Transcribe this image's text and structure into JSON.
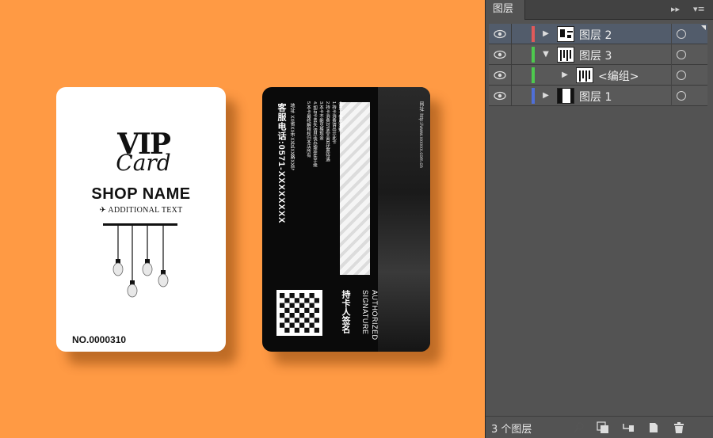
{
  "front_card": {
    "logo_vip": "VIP",
    "logo_card": "Card",
    "shop_name": "SHOP NAME",
    "additional_text": "ADDITIONAL TEXT",
    "card_number": "NO.0000310"
  },
  "back_card": {
    "phone": "客服电话:0571-XXXXXXXX",
    "address": "地址: XX省XX市XX区XX路XX号",
    "rules": [
      "会员卡使用须知",
      "1.持卡消费请出示此卡",
      "2.持卡消费可享受会员优惠待遇",
      "3.本卡不能兑换现金",
      "4.如有卡丢失,请尽快办理挂失手续",
      "5.本卡最终解释权归本店所有"
    ],
    "website": "网址: http://www.xxxxxx.com.cn",
    "authorized_line1": "AUTHORIZED",
    "authorized_line2": "SIGNATURE",
    "holder_signature": "持卡人签名"
  },
  "layers_panel": {
    "tab_label": "图层",
    "layers": [
      {
        "name": "图层 2",
        "color": "#e05a5a",
        "expanded": false,
        "selected": true
      },
      {
        "name": "图层 3",
        "color": "#4ec94e",
        "expanded": true,
        "selected": false
      },
      {
        "name": "<编组>",
        "color": "#4ec94e",
        "expanded": false,
        "selected": false,
        "child": true
      },
      {
        "name": "图层 1",
        "color": "#4f6fd8",
        "expanded": false,
        "selected": false
      }
    ],
    "layer_count": "3 个图层",
    "footer_buttons": [
      "locate-object",
      "make-clipping-mask",
      "create-sublayer",
      "create-new-layer",
      "delete-layer"
    ]
  },
  "colors": {
    "canvas_bg": "#ff9a44",
    "panel_bg": "#535353",
    "selected_row": "#525c6b"
  }
}
